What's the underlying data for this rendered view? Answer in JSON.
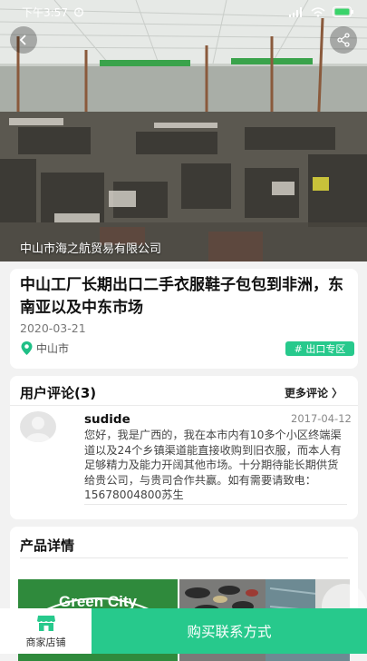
{
  "status_bar": {
    "time": "下午3:57"
  },
  "colors": {
    "accent": "#27c98c",
    "tag_bg": "#27c98c",
    "location_pin": "#1fbf86"
  },
  "icons": {
    "back": "chevron-left-icon",
    "share": "share-icon",
    "location": "map-pin-icon",
    "store": "store-icon",
    "more": "chevron-right-icon"
  },
  "hero": {
    "company_name": "中山市海之航贸易有限公司"
  },
  "listing": {
    "title": "中山工厂长期出口二手衣服鞋子包包到非洲，东南亚以及中东市场",
    "date": "2020-03-21",
    "location": "中山市",
    "tag": "# 出口专区"
  },
  "comments": {
    "header": "用户评论(3)",
    "more_label": "更多评论 〉",
    "items": [
      {
        "user": "sudide",
        "date": "2017-04-12",
        "text": "您好，我是广西的，我在本市内有10多个小区终端渠道以及24个乡镇渠道能直接收购到旧衣服，而本人有足够精力及能力开阔其他市场。十分期待能长期供货给贵公司，与贵司合作共赢。如有需要请致电：15678004800苏生"
      }
    ]
  },
  "details": {
    "header": "产品详情",
    "image_text": "Green City"
  },
  "bottom_bar": {
    "store_label": "商家店铺",
    "buy_label": "购买联系方式"
  }
}
